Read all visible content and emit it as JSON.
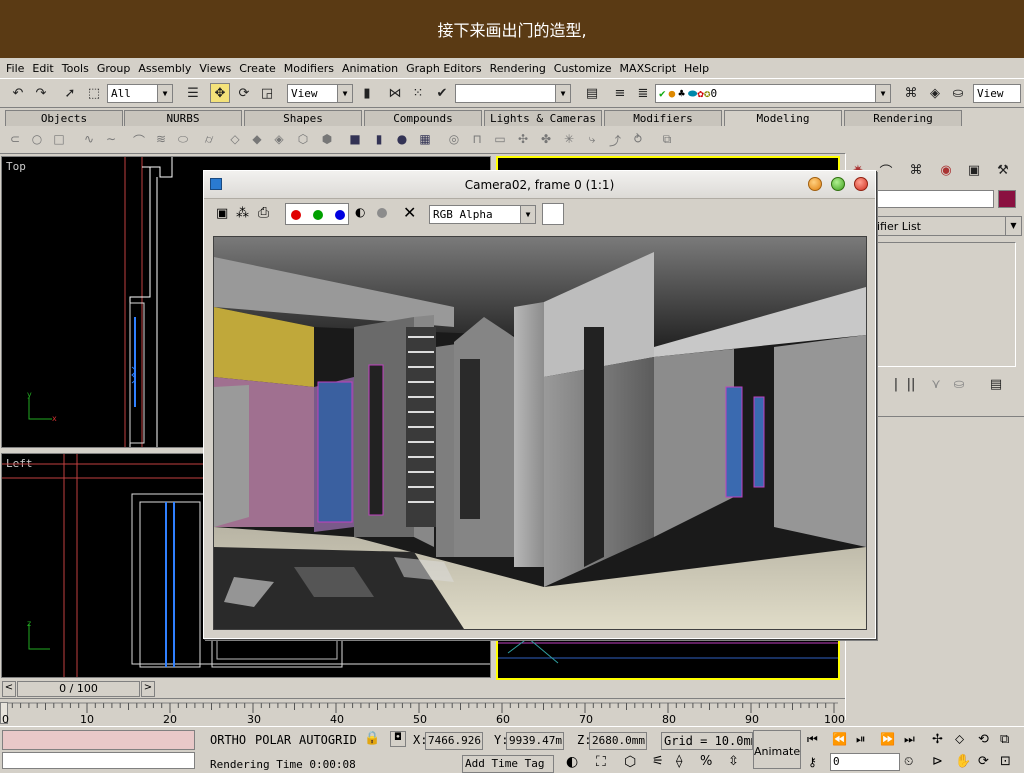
{
  "caption": "接下来画出门的造型,",
  "menu": [
    "File",
    "Edit",
    "Tools",
    "Group",
    "Assembly",
    "Views",
    "Create",
    "Modifiers",
    "Animation",
    "Graph Editors",
    "Rendering",
    "Customize",
    "MAXScript",
    "Help"
  ],
  "toolbar": {
    "selection_filter": "All",
    "ref_coord": "View",
    "named_selection": "",
    "layer": "0",
    "render_view": "View"
  },
  "tabs": [
    "Objects",
    "NURBS",
    "Shapes",
    "Compounds",
    "Lights & Cameras",
    "Modifiers",
    "Modeling",
    "Rendering"
  ],
  "active_tab": "Modeling",
  "viewports": {
    "top": "Top",
    "left": "Left"
  },
  "render_window": {
    "title": "Camera02, frame 0 (1:1)",
    "channel": "RGB Alpha"
  },
  "command_panel": {
    "modifier_list": "ifier List"
  },
  "time_slider": {
    "position": "0 / 100",
    "ticks": [
      "0",
      "10",
      "20",
      "30",
      "40",
      "50",
      "60",
      "70",
      "80",
      "90",
      "100"
    ]
  },
  "status": {
    "snap_modes": [
      "ORTHO",
      "POLAR",
      "AUTOGRID"
    ],
    "x_label": "X:",
    "x": "7466.926",
    "y_label": "Y:",
    "y": "9939.47m",
    "z_label": "Z:",
    "z": "2680.0mm",
    "grid": "Grid = 10.0mm",
    "animate": "Animate",
    "render_time": "Rendering Time  0:00:08",
    "add_time_tag": "Add Time Tag",
    "frame": "0"
  },
  "colors": {
    "caption_bg": "#5a3a14",
    "ui_gray": "#d4d0c8",
    "viewport_bg": "#000000",
    "active_viewport_border": "#ffff00"
  }
}
